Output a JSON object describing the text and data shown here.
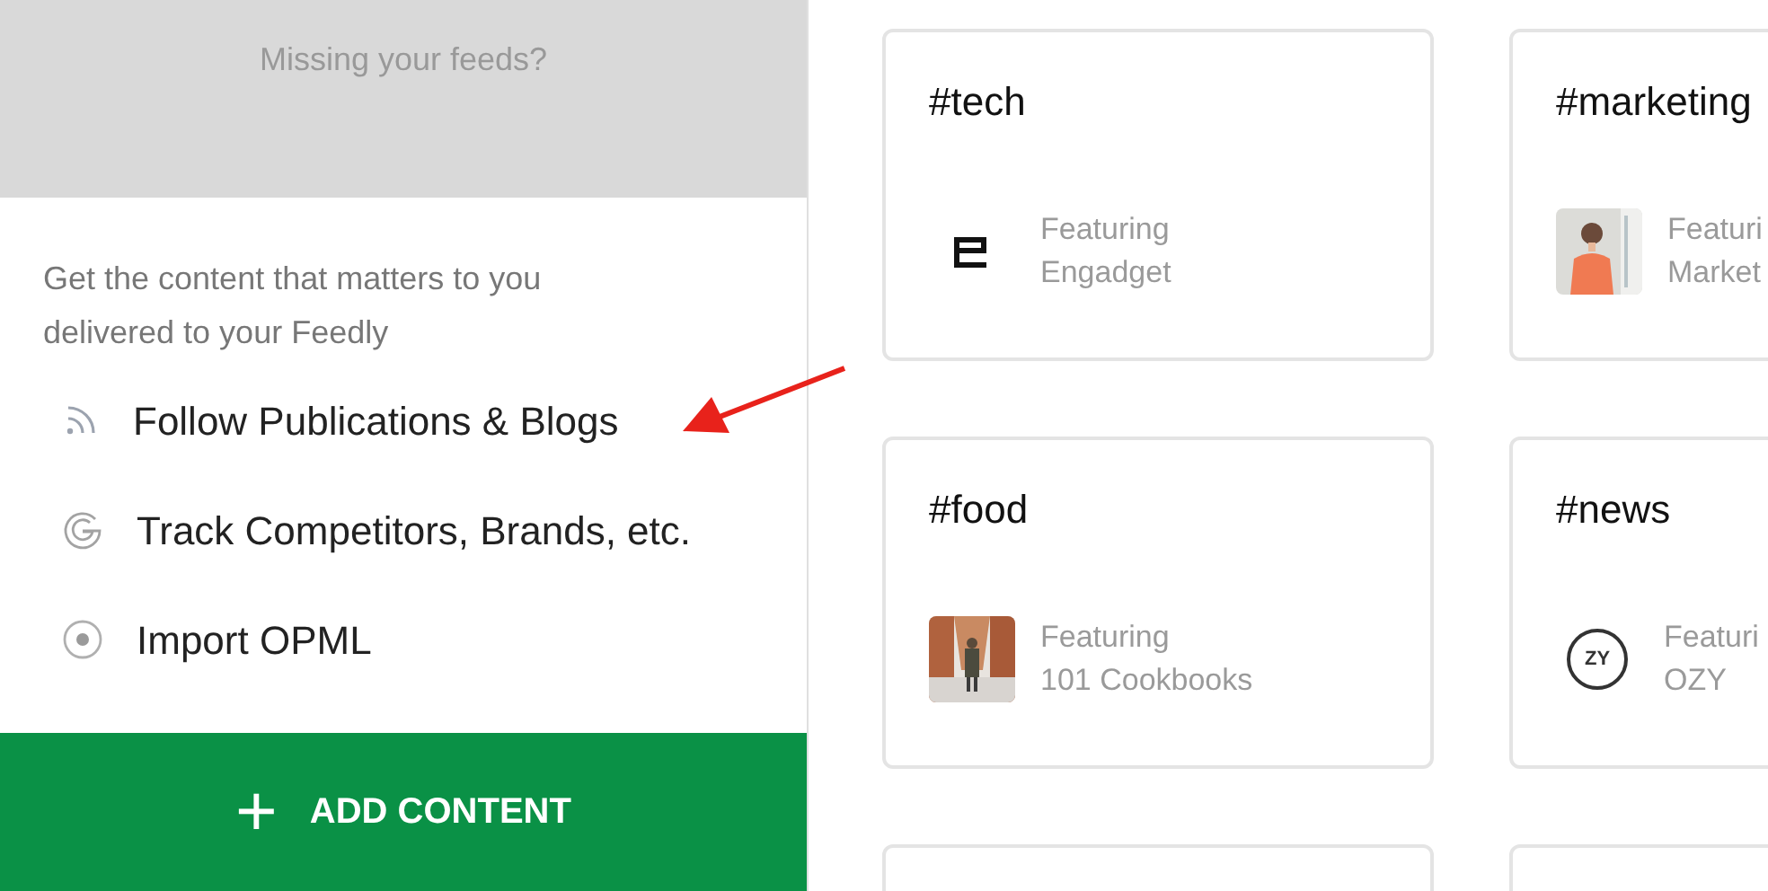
{
  "sidebar": {
    "notice": "Missing your feeds?",
    "intro": "Get the content that matters to you delivered to your Feedly",
    "options": [
      {
        "kind": "rss",
        "label": "Follow Publications & Blogs"
      },
      {
        "kind": "google",
        "label": "Track Competitors, Brands, etc."
      },
      {
        "kind": "opml",
        "label": "Import OPML"
      }
    ],
    "add_button": {
      "icon": "+",
      "label": "ADD CONTENT"
    }
  },
  "cards": [
    {
      "title": "#tech",
      "kind": "logo-e",
      "featuring": "Featuring",
      "source": "Engadget"
    },
    {
      "title": "#marketing",
      "kind": "picture",
      "featuring": "Featuri",
      "source": "Market"
    },
    {
      "title": "#food",
      "kind": "picture",
      "featuring": "Featuring",
      "source": "101 Cookbooks"
    },
    {
      "title": "#news",
      "kind": "logo-text",
      "logo_text": "ZY",
      "featuring": "Featuri",
      "source": "OZY"
    },
    {
      "kind": "empty"
    },
    {
      "kind": "empty"
    }
  ]
}
